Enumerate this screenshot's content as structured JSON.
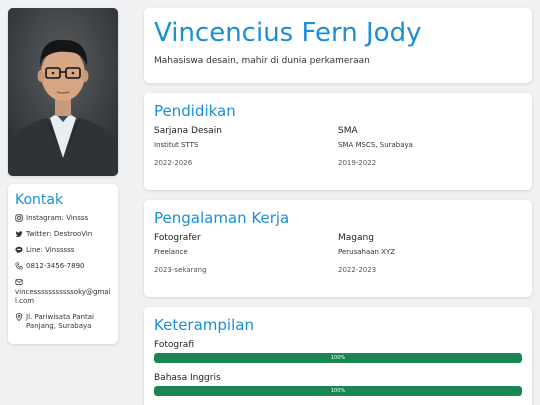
{
  "profile": {
    "name": "Vincencius Fern Jody",
    "tagline": "Mahasiswa desain, mahir di dunia perkameraan"
  },
  "contact": {
    "title": "Kontak",
    "items": [
      {
        "icon": "instagram-icon",
        "text": "Instagram: Vinsss"
      },
      {
        "icon": "twitter-icon",
        "text": "Twitter: DestrooVin"
      },
      {
        "icon": "line-chat-icon",
        "text": "Line: Vinsssss"
      },
      {
        "icon": "phone-icon",
        "text": "0812-3456-7890"
      },
      {
        "icon": "envelope-icon",
        "text": "vincesssssssssssoky@gmail.com"
      },
      {
        "icon": "map-pin-icon",
        "text": "Jl. Pariwisata Pantai Panjang, Surabaya"
      }
    ]
  },
  "education": {
    "title": "Pendidikan",
    "entries": [
      {
        "degree": "Sarjana Desain",
        "school": "Institut STTS",
        "years": "2022-2026"
      },
      {
        "degree": "SMA",
        "school": "SMA MSCS, Surabaya",
        "years": "2019-2022"
      }
    ]
  },
  "experience": {
    "title": "Pengalaman Kerja",
    "entries": [
      {
        "role": "Fotografer",
        "company": "Freelance",
        "years": "2023-sekarang"
      },
      {
        "role": "Magang",
        "company": "Perusahaan XYZ",
        "years": "2022-2023"
      }
    ]
  },
  "skills": {
    "title": "Keterampilan",
    "items": [
      {
        "name": "Fotografi",
        "level": 100,
        "label": "100%"
      },
      {
        "name": "Bahasa Inggris",
        "level": 100,
        "label": "100%"
      }
    ]
  },
  "colors": {
    "accent": "#1a8fd6",
    "bar": "#198754",
    "background": "#f0f1f3"
  }
}
